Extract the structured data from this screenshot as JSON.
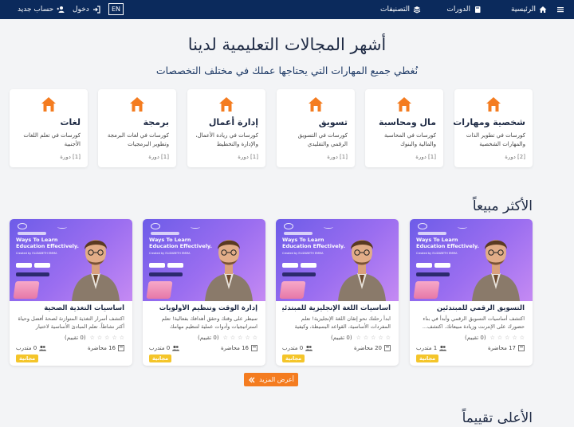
{
  "nav": {
    "home": "الرئيسية",
    "courses": "الدورات",
    "categories": "التصنيفات",
    "lang": "EN",
    "login": "دخول",
    "signup": "حساب جديد"
  },
  "hero": {
    "title": "أشهر المجالات التعليمية لدينا",
    "subtitle": "نُغطي جميع المهارات التي يحتاجها عملك في مختلف التخصصات"
  },
  "categories": [
    {
      "title": "شخصية ومهارات",
      "desc": "كورسات في تطوير الذات والمهارات الشخصية",
      "count": "[2] دورة"
    },
    {
      "title": "مال ومحاسبة",
      "desc": "كورسات في المحاسبة والمالية والبنوك",
      "count": "[1] دورة"
    },
    {
      "title": "تسويق",
      "desc": "كورسات في التسويق الرقمي والتقليدي",
      "count": "[1] دورة"
    },
    {
      "title": "إدارة أعمال",
      "desc": "كورسات في ريادة الأعمال، والإدارة والتخطيط",
      "count": "[1] دورة"
    },
    {
      "title": "برمجة",
      "desc": "كورسات في لغات البرمجة وتطوير البرمجيات",
      "count": "[1] دورة"
    },
    {
      "title": "لغات",
      "desc": "كورسات في تعلم اللغات الأجنبية",
      "count": "[1] دورة"
    }
  ],
  "best_selling": {
    "title": "الأكثر مبيعاً",
    "courses": [
      {
        "title": "التسويق الرقمي للمبتدئين",
        "desc": "اكتشف أساسيات التسويق الرقمي وأبدأ في بناء حضورك على الإنترنت وزيادة مبيعاتك. اكتشف...",
        "rating": "(0 تقييم)",
        "lectures": "17 محاضرة",
        "students": "1 متدرب",
        "badge": "مجانية"
      },
      {
        "title": "أساسيات اللغة الإنجليزية للمبتدئين",
        "desc": "ابدأ رحلتك نحو إتقان اللغة الإنجليزية! تعلم المفردات الأساسية، القواعد البسيطة، وكيفية إجراء محادثات...",
        "rating": "(0 تقييم)",
        "lectures": "20 محاضرة",
        "students": "0 متدرب",
        "badge": "مجانية"
      },
      {
        "title": "إدارة الوقت وتنظيم الأولويات",
        "desc": "سيطر على وقتك وحقق أهدافك بفعالية! تعلم استراتيجيات وأدوات عملية لتنظيم مهامك وتحديد...",
        "rating": "(0 تقييم)",
        "lectures": "16 محاضرة",
        "students": "0 متدرب",
        "badge": "مجانية"
      },
      {
        "title": "أساسيات التغذية الصحية",
        "desc": "اكتشف أسرار التغذية المتوازنة لصحة أفضل وحياة أكثر نشاطاً. تعلم المبادئ الأساسية لاختيار الأطعمة...",
        "rating": "(0 تقييم)",
        "lectures": "16 محاضرة",
        "students": "0 متدرب",
        "badge": "مجانية"
      }
    ],
    "thumb": {
      "headline": "Ways To Learn Education Effectively.",
      "byline": "Created by ELIZABETH EMMA"
    }
  },
  "more_button": "أعرض المزيد",
  "top_rated": {
    "title": "الأعلى تقييماً"
  },
  "colors": {
    "nav": "#0b2a5c",
    "accent": "#f47c20",
    "badge": "#f4c52a"
  },
  "icons": {
    "home": "home-icon",
    "courses": "book-icon",
    "categories": "layers-icon",
    "login": "login-icon",
    "signup": "user-plus-icon",
    "category": "house-icon"
  }
}
